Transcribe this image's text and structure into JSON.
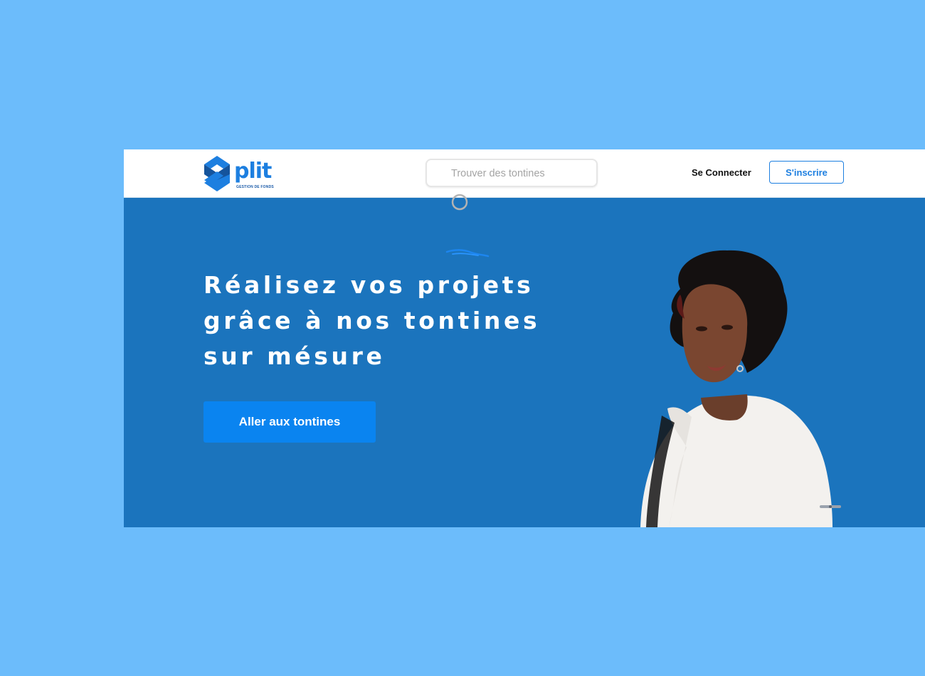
{
  "brand": {
    "logo_text": "plit",
    "tagline": "GESTION DE FONDS",
    "color": "#1d7fe0"
  },
  "header": {
    "search": {
      "placeholder": "Trouver des tontines",
      "icon": "search-icon"
    },
    "login_label": "Se Connecter",
    "signup_label": "S'inscrire"
  },
  "hero": {
    "title_lines": [
      "Réalisez vos projets",
      "grâce à nos tontines",
      "sur mésure"
    ],
    "cta_label": "Aller aux tontines",
    "background": "#1b74bd",
    "cta_color": "#0a84f0"
  },
  "page_background": "#6cbcfb"
}
